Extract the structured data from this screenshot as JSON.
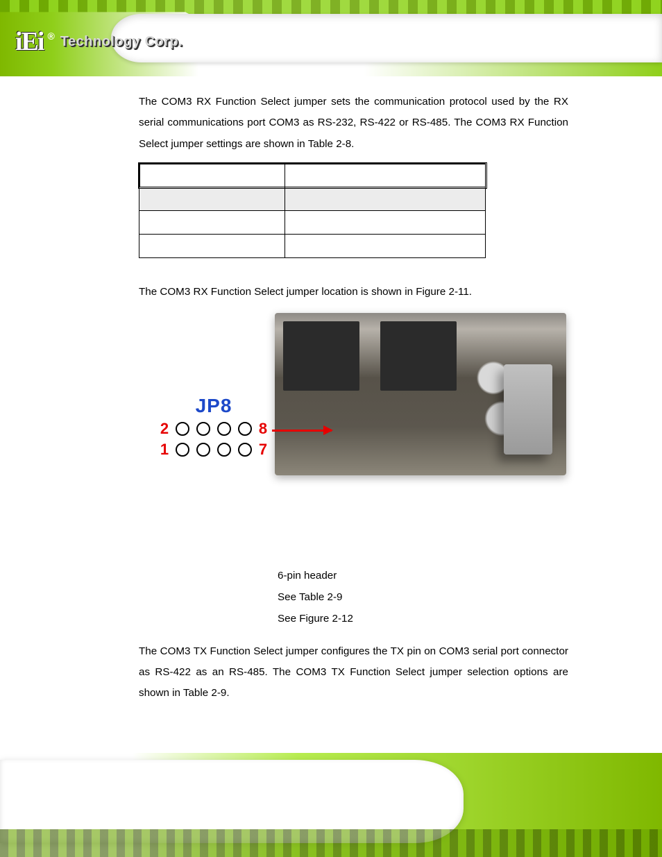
{
  "logo": {
    "mark": "iEi",
    "reg": "®",
    "text": "Technology Corp."
  },
  "intro_paragraph": "The COM3 RX Function Select jumper sets the communication protocol used by the RX serial communications port COM3 as RS-232, RS-422 or RS-485. The COM3 RX Function Select jumper settings are shown in Table 2-8.",
  "settings_table": {
    "rows": [
      {
        "c1": "",
        "c2": ""
      },
      {
        "c1": "",
        "c2": ""
      },
      {
        "c1": "",
        "c2": ""
      },
      {
        "c1": "",
        "c2": ""
      }
    ]
  },
  "mid_paragraph": "The COM3 RX Function Select jumper location is shown in Figure 2-11.",
  "figure": {
    "jp_label": "JP8",
    "pin_left_top": "2",
    "pin_left_bottom": "1",
    "pin_right_top": "8",
    "pin_right_bottom": "7"
  },
  "info": {
    "type_value": "6-pin header",
    "settings_value": "See Table 2-9",
    "location_value": "See Figure 2-12"
  },
  "intro_paragraph_2": "The COM3 TX Function Select jumper configures the TX pin on COM3 serial port connector as RS-422 as an RS-485. The COM3 TX Function Select jumper selection options are shown in Table 2-9."
}
